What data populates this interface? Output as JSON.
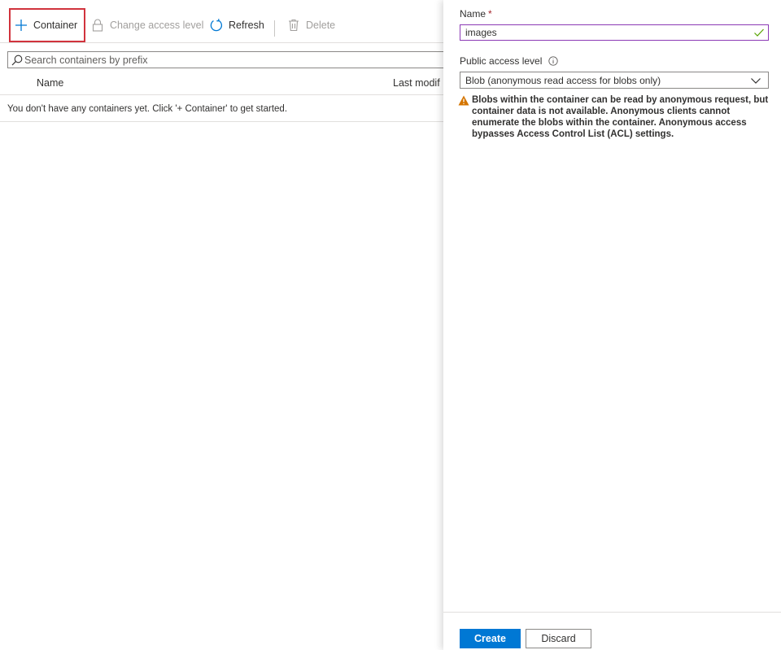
{
  "toolbar": {
    "add_container_label": "Container",
    "change_access_label": "Change access level",
    "refresh_label": "Refresh",
    "delete_label": "Delete"
  },
  "search": {
    "placeholder": "Search containers by prefix",
    "value": ""
  },
  "table": {
    "columns": [
      "Name",
      "Last modif"
    ],
    "empty_message": "You don't have any containers yet. Click '+ Container' to get started."
  },
  "panel": {
    "name_label": "Name",
    "name_required_marker": "*",
    "name_value": "images",
    "access_label": "Public access level",
    "access_value": "Blob (anonymous read access for blobs only)",
    "warning_text": "Blobs within the container can be read by anonymous request, but container data is not available. Anonymous clients cannot enumerate the blobs within the container. Anonymous access bypasses Access Control List (ACL) settings.",
    "create_label": "Create",
    "discard_label": "Discard"
  },
  "colors": {
    "accent": "#0078d4",
    "highlight_box": "#d1333d",
    "input_focus_border": "#8b3ab5",
    "valid_check": "#57a300",
    "warning": "#d47500",
    "required": "#a4262c"
  },
  "icons": {
    "add": "plus-icon",
    "change_access": "lock-icon",
    "refresh": "refresh-icon",
    "delete": "trash-icon",
    "search": "search-icon",
    "valid": "checkmark-icon",
    "info": "info-icon",
    "dropdown": "chevron-down-icon",
    "warning": "warning-icon"
  }
}
